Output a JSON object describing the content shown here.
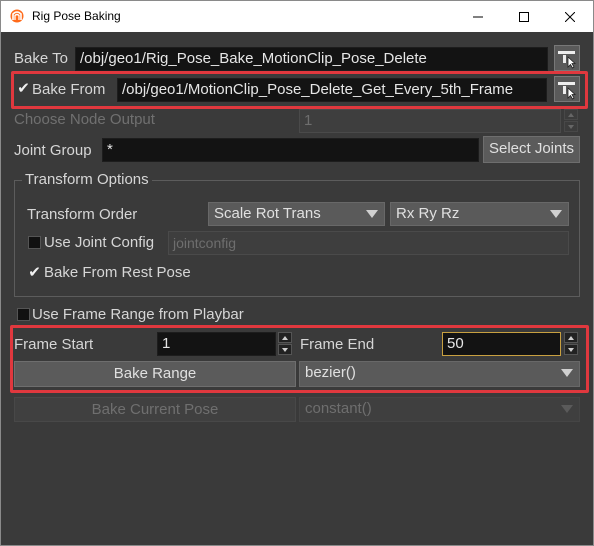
{
  "window": {
    "title": "Rig Pose Baking",
    "minimize_glyph": "—",
    "maximize_glyph": "☐",
    "close_glyph": "✕"
  },
  "bake_to": {
    "label": "Bake To",
    "value": "/obj/geo1/Rig_Pose_Bake_MotionClip_Pose_Delete"
  },
  "bake_from": {
    "label": "Bake From",
    "checked": true,
    "value": "/obj/geo1/MotionClip_Pose_Delete_Get_Every_5th_Frame"
  },
  "node_output": {
    "label": "Choose Node Output",
    "value": "1"
  },
  "joint_group": {
    "label": "Joint Group",
    "value": "*",
    "select_button": "Select Joints"
  },
  "transform_options": {
    "group_label": "Transform Options",
    "order_label": "Transform Order",
    "order_value": "Scale Rot Trans",
    "rot_order_value": "Rx Ry Rz",
    "use_joint_config_label": "Use Joint Config",
    "joint_config_placeholder": "jointconfig",
    "bake_rest_label": "Bake From Rest Pose"
  },
  "playbar": {
    "label": "Use Frame Range from Playbar"
  },
  "frames": {
    "start_label": "Frame Start",
    "start_value": "1",
    "end_label": "Frame End",
    "end_value": "50"
  },
  "bake_range": {
    "button": "Bake Range",
    "interp": "bezier()"
  },
  "bake_current": {
    "button": "Bake Current Pose",
    "interp": "constant()"
  },
  "colors": {
    "highlight": "#e0383e",
    "panel": "#3a3a3a",
    "field": "#131313",
    "active_field_border": "#c8a040"
  },
  "icons": {
    "logo": "houdini-logo-icon",
    "node_picker": "node-picker-icon",
    "checkmark": "checkmark-icon"
  }
}
